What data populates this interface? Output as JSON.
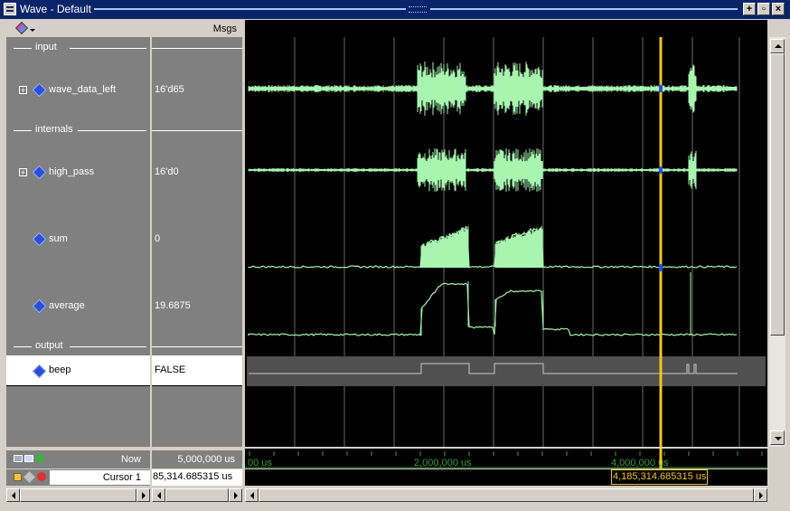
{
  "window": {
    "title": "Wave - Default"
  },
  "header": {
    "msgs_label": "Msgs"
  },
  "sections": [
    {
      "label": "input"
    },
    {
      "label": "internals"
    },
    {
      "label": "output"
    }
  ],
  "signals": [
    {
      "name": "wave_data_left",
      "value": "16'd65",
      "expandable": true
    },
    {
      "name": "high_pass",
      "value": "16'd0",
      "expandable": true
    },
    {
      "name": "sum",
      "value": "0",
      "expandable": false
    },
    {
      "name": "average",
      "value": "19.6875",
      "expandable": false
    },
    {
      "name": "beep",
      "value": "FALSE",
      "expandable": false
    }
  ],
  "footer": {
    "now_label": "Now",
    "now_value": "5,000,000 us",
    "cursor_label": "Cursor 1",
    "cursor_value": "85,314.685315 us",
    "cursor_readout": "4,185,314.685315 us",
    "timeline_labels": [
      "00 us",
      "2,000,000 us",
      "4,000,000 us"
    ]
  },
  "colors": {
    "wave": "#a8f5b0",
    "cursor": "#f5c518",
    "titlebar": "#0a246a"
  }
}
